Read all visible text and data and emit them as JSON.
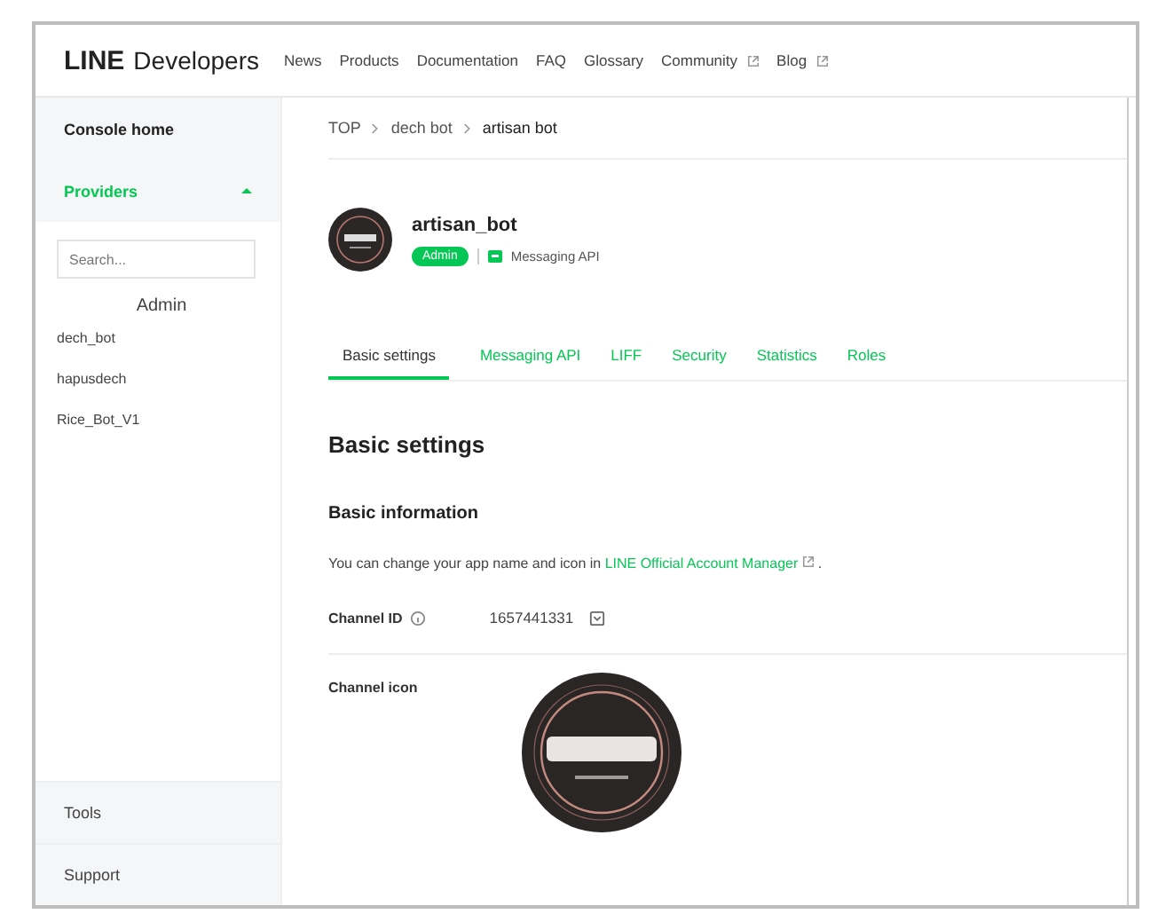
{
  "header": {
    "logo_bold": "LINE",
    "logo_text": "Developers",
    "nav": [
      {
        "label": "News",
        "external": false
      },
      {
        "label": "Products",
        "external": false
      },
      {
        "label": "Documentation",
        "external": false
      },
      {
        "label": "FAQ",
        "external": false
      },
      {
        "label": "Glossary",
        "external": false
      },
      {
        "label": "Community",
        "external": true
      },
      {
        "label": "Blog",
        "external": true
      }
    ]
  },
  "sidebar": {
    "console_home": "Console home",
    "providers": {
      "label": "Providers",
      "expanded": true
    },
    "search": {
      "placeholder": "Search..."
    },
    "group": "Admin",
    "items": [
      "dech_bot",
      "hapusdech",
      "Rice_Bot_V1"
    ],
    "bottom": [
      "Tools",
      "Support"
    ]
  },
  "breadcrumb": [
    "TOP",
    "dech bot",
    "artisan bot"
  ],
  "channel": {
    "name": "artisan_bot",
    "role": "Admin",
    "type": "Messaging API"
  },
  "tabs": [
    {
      "label": "Basic settings",
      "selected": true
    },
    {
      "label": "Messaging API",
      "selected": false
    },
    {
      "label": "LIFF",
      "selected": false
    },
    {
      "label": "Security",
      "selected": false
    },
    {
      "label": "Statistics",
      "selected": false
    },
    {
      "label": "Roles",
      "selected": false
    }
  ],
  "title": "Basic settings",
  "section": "Basic information",
  "note": {
    "text": "You can change your app name and icon in",
    "link": "LINE Official Account Manager",
    "end": "."
  },
  "fields": [
    {
      "kind": "id",
      "label": "Channel ID",
      "value": "1657441331"
    },
    {
      "kind": "icon",
      "label": "Channel icon"
    }
  ]
}
